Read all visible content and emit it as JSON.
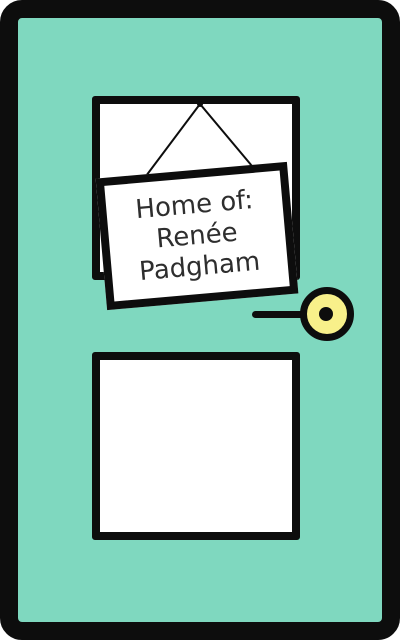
{
  "door": {
    "color": "#7fd8bf",
    "outline_color": "#0d0d0d",
    "knob_color": "#f8f08a"
  },
  "sign": {
    "line1": "Home of:",
    "line2": "Renée",
    "line3": "Padgham"
  }
}
